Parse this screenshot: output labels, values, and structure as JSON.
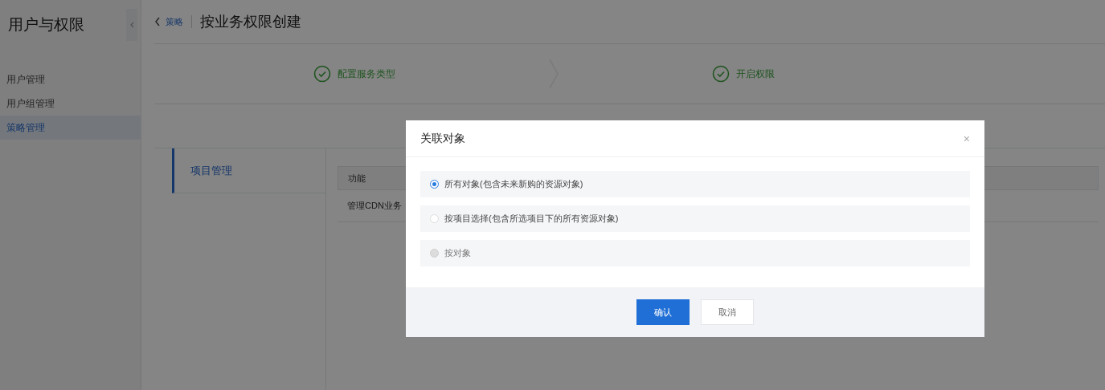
{
  "sidebar": {
    "title": "用户与权限",
    "items": [
      {
        "label": "用户管理",
        "selected": false
      },
      {
        "label": "用户组管理",
        "selected": false
      },
      {
        "label": "策略管理",
        "selected": true
      }
    ]
  },
  "header": {
    "breadcrumb": "策略",
    "title": "按业务权限创建"
  },
  "steps": [
    {
      "label": "配置服务类型",
      "done": true
    },
    {
      "label": "开启权限",
      "done": true
    }
  ],
  "section_tabs": [
    {
      "label": "项目管理",
      "selected": true
    }
  ],
  "table": {
    "columns": [
      "功能"
    ],
    "rows": [
      [
        "管理CDN业务"
      ]
    ]
  },
  "dialog": {
    "title": "关联对象",
    "close": "×",
    "options": [
      {
        "label": "所有对象(包含未来新购的资源对象)",
        "selected": true,
        "disabled": false
      },
      {
        "label": "按项目选择(包含所选项目下的所有资源对象)",
        "selected": false,
        "disabled": false
      },
      {
        "label": "按对象",
        "selected": false,
        "disabled": true
      }
    ],
    "buttons": [
      {
        "label": "确认",
        "kind": "primary"
      },
      {
        "label": "取消",
        "kind": "secondary"
      }
    ]
  }
}
